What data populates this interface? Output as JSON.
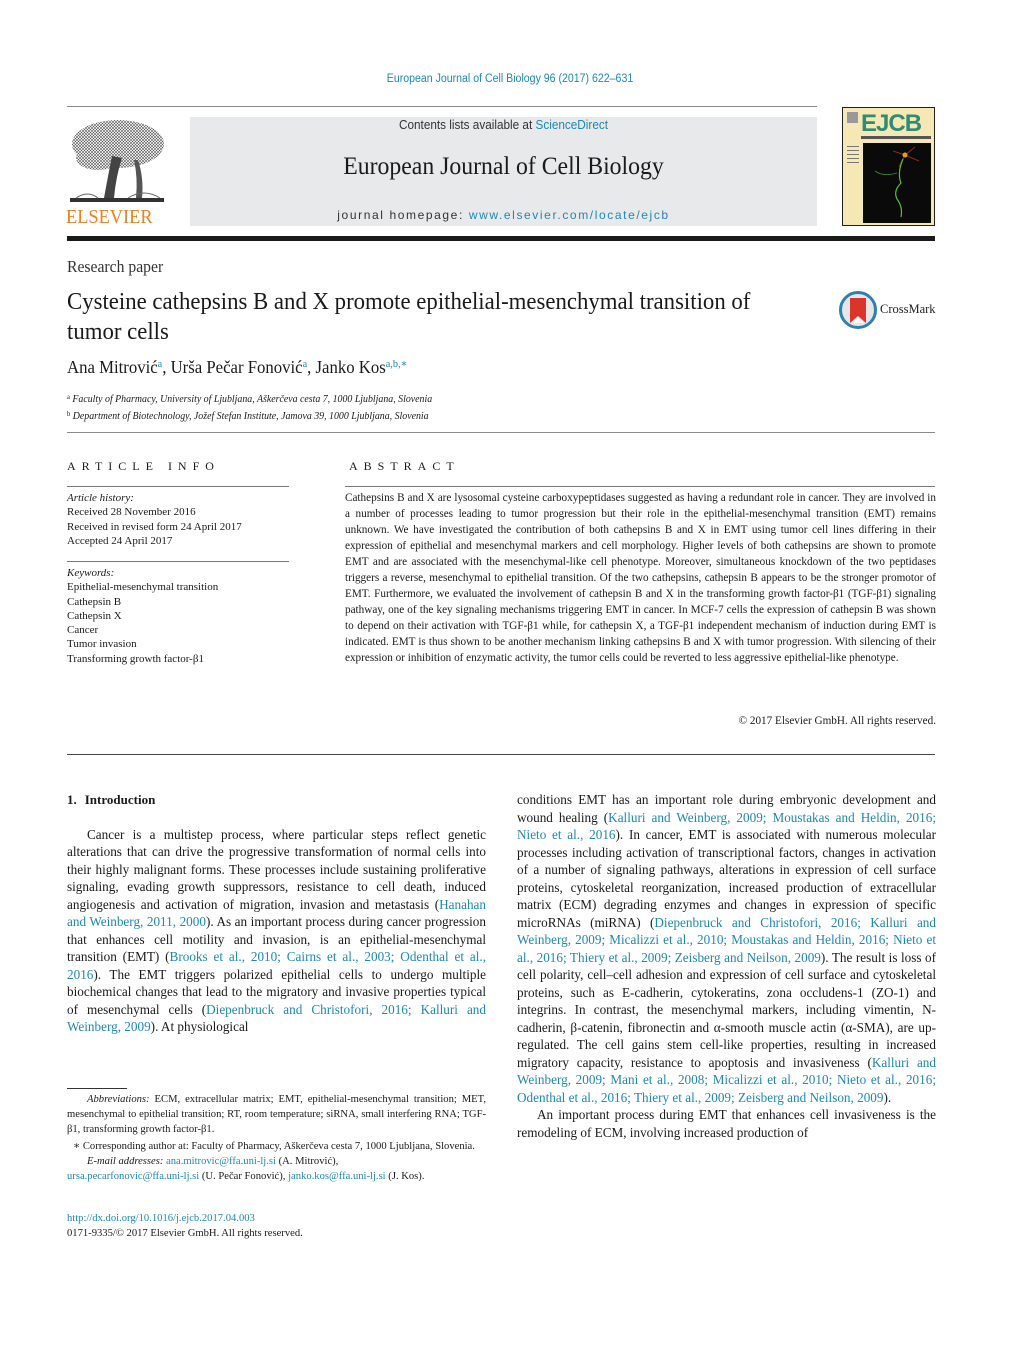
{
  "header": {
    "citation": "European Journal of Cell Biology 96 (2017) 622–631",
    "contents_prefix": "Contents lists available at ",
    "contents_link": "ScienceDirect",
    "journal_name": "European Journal of Cell Biology",
    "homepage_prefix": "journal homepage: ",
    "homepage_url": "www.elsevier.com/locate/ejcb",
    "publisher_logo": "ELSEVIER",
    "cover_title": "EJCB"
  },
  "colors": {
    "link": "#1e88b4",
    "elsevier_orange": "#f07f1e",
    "masthead_gray": "#e8e9ea",
    "cover_yellow": "#f6e8b4",
    "cover_teal": "#2e8b74",
    "crossmark_red": "#d9352a"
  },
  "article": {
    "type": "Research paper",
    "title": "Cysteine cathepsins B and X promote epithelial-mesenchymal transition of tumor cells",
    "crossmark_label": "CrossMark",
    "authors": [
      {
        "name": "Ana Mitrović",
        "sup": "a"
      },
      {
        "name": "Urša Pečar Fonović",
        "sup": "a"
      },
      {
        "name": "Janko Kos",
        "sup": "a,b,∗"
      }
    ],
    "affiliations": [
      {
        "sup": "a",
        "text": "Faculty of Pharmacy, University of Ljubljana, Aškerčeva cesta 7, 1000 Ljubljana, Slovenia"
      },
      {
        "sup": "b",
        "text": "Department of Biotechnology, Jožef Stefan Institute, Jamova 39, 1000 Ljubljana, Slovenia"
      }
    ]
  },
  "article_info": {
    "heading": "ARTICLE INFO",
    "history_label": "Article history:",
    "history": [
      "Received 28 November 2016",
      "Received in revised form 24 April 2017",
      "Accepted 24 April 2017"
    ],
    "keywords_label": "Keywords:",
    "keywords": [
      "Epithelial-mesenchymal transition",
      "Cathepsin B",
      "Cathepsin X",
      "Cancer",
      "Tumor invasion",
      "Transforming growth factor-β1"
    ]
  },
  "abstract": {
    "heading": "ABSTRACT",
    "text": "Cathepsins B and X are lysosomal cysteine carboxypeptidases suggested as having a redundant role in cancer. They are involved in a number of processes leading to tumor progression but their role in the epithelial-mesenchymal transition (EMT) remains unknown. We have investigated the contribution of both cathepsins B and X in EMT using tumor cell lines differing in their expression of epithelial and mesenchymal markers and cell morphology. Higher levels of both cathepsins are shown to promote EMT and are associated with the mesenchymal-like cell phenotype. Moreover, simultaneous knockdown of the two peptidases triggers a reverse, mesenchymal to epithelial transition. Of the two cathepsins, cathepsin B appears to be the stronger promotor of EMT. Furthermore, we evaluated the involvement of cathepsin B and X in the transforming growth factor-β1 (TGF-β1) signaling pathway, one of the key signaling mechanisms triggering EMT in cancer. In MCF-7 cells the expression of cathepsin B was shown to depend on their activation with TGF-β1 while, for cathepsin X, a TGF-β1 independent mechanism of induction during EMT is indicated. EMT is thus shown to be another mechanism linking cathepsins B and X with tumor progression. With silencing of their expression or inhibition of enzymatic activity, the tumor cells could be reverted to less aggressive epithelial-like phenotype.",
    "copyright": "© 2017 Elsevier GmbH. All rights reserved."
  },
  "body": {
    "section_number": "1.",
    "section_title": "Introduction",
    "left_para": [
      {
        "t": "Cancer is a multistep process, where particular steps reflect genetic alterations that can drive the progressive transformation of normal cells into their highly malignant forms. These processes include sustaining proliferative signaling, evading growth suppressors, resistance to cell death, induced angiogenesis and activation of migration, invasion and metastasis ("
      },
      {
        "l": "Hanahan and Weinberg, 2011, 2000"
      },
      {
        "t": "). As an important process during cancer progression that enhances cell motility and invasion, is an epithelial-mesenchymal transition (EMT) ("
      },
      {
        "l": "Brooks et al., 2010; Cairns et al., 2003; Odenthal et al., 2016"
      },
      {
        "t": "). The EMT triggers polarized epithelial cells to undergo multiple biochemical changes that lead to the migratory and invasive properties typical of mesenchymal cells ("
      },
      {
        "l": "Diepenbruck and Christofori, 2016; Kalluri and Weinberg, 2009"
      },
      {
        "t": "). At physiological"
      }
    ],
    "right_para1": [
      {
        "t": "conditions EMT has an important role during embryonic development and wound healing ("
      },
      {
        "l": "Kalluri and Weinberg, 2009; Moustakas and Heldin, 2016; Nieto et al., 2016"
      },
      {
        "t": "). In cancer, EMT is associated with numerous molecular processes including activation of transcriptional factors, changes in activation of a number of signaling pathways, alterations in expression of cell surface proteins, cytoskeletal reorganization, increased production of extracellular matrix (ECM) degrading enzymes and changes in expression of specific microRNAs (miRNA) ("
      },
      {
        "l": "Diepenbruck and Christofori, 2016; Kalluri and Weinberg, 2009; Micalizzi et al., 2010; Moustakas and Heldin, 2016; Nieto et al., 2016; Thiery et al., 2009; Zeisberg and Neilson, 2009"
      },
      {
        "t": "). The result is loss of cell polarity, cell–cell adhesion and expression of cell surface and cytoskeletal proteins, such as E-cadherin, cytokeratins, zona occludens-1 (ZO-1) and integrins. In contrast, the mesenchymal markers, including vimentin, N-cadherin, β-catenin, fibronectin and α-smooth muscle actin (α-SMA), are up-regulated. The cell gains stem cell-like properties, resulting in increased migratory capacity, resistance to apoptosis and invasiveness ("
      },
      {
        "l": "Kalluri and Weinberg, 2009; Mani et al., 2008; Micalizzi et al., 2010; Nieto et al., 2016; Odenthal et al., 2016; Thiery et al., 2009; Zeisberg and Neilson, 2009"
      },
      {
        "t": ")."
      }
    ],
    "right_para2": "An important process during EMT that enhances cell invasiveness is the remodeling of ECM, involving increased production of"
  },
  "footnotes": {
    "abbrev_label": "Abbreviations:",
    "abbrev_text": " ECM, extracellular matrix; EMT, epithelial-mesenchymal transition; MET, mesenchymal to epithelial transition; RT, room temperature; siRNA, small interfering RNA; TGF-β1, transforming growth factor-β1.",
    "corresponding": "∗ Corresponding author at: Faculty of Pharmacy, Aškerčeva cesta 7, 1000 Ljubljana, Slovenia.",
    "email_label": "E-mail addresses:",
    "emails": [
      {
        "addr": "ana.mitrovic@ffa.uni-lj.si",
        "who": " (A. Mitrović),"
      },
      {
        "addr": "ursa.pecarfonovic@ffa.uni-lj.si",
        "who": " (U. Pečar Fonović), "
      },
      {
        "addr": "janko.kos@ffa.uni-lj.si",
        "who": " (J. Kos)."
      }
    ]
  },
  "doi": {
    "url": "http://dx.doi.org/10.1016/j.ejcb.2017.04.003",
    "issn_line": "0171-9335/© 2017 Elsevier GmbH. All rights reserved."
  }
}
